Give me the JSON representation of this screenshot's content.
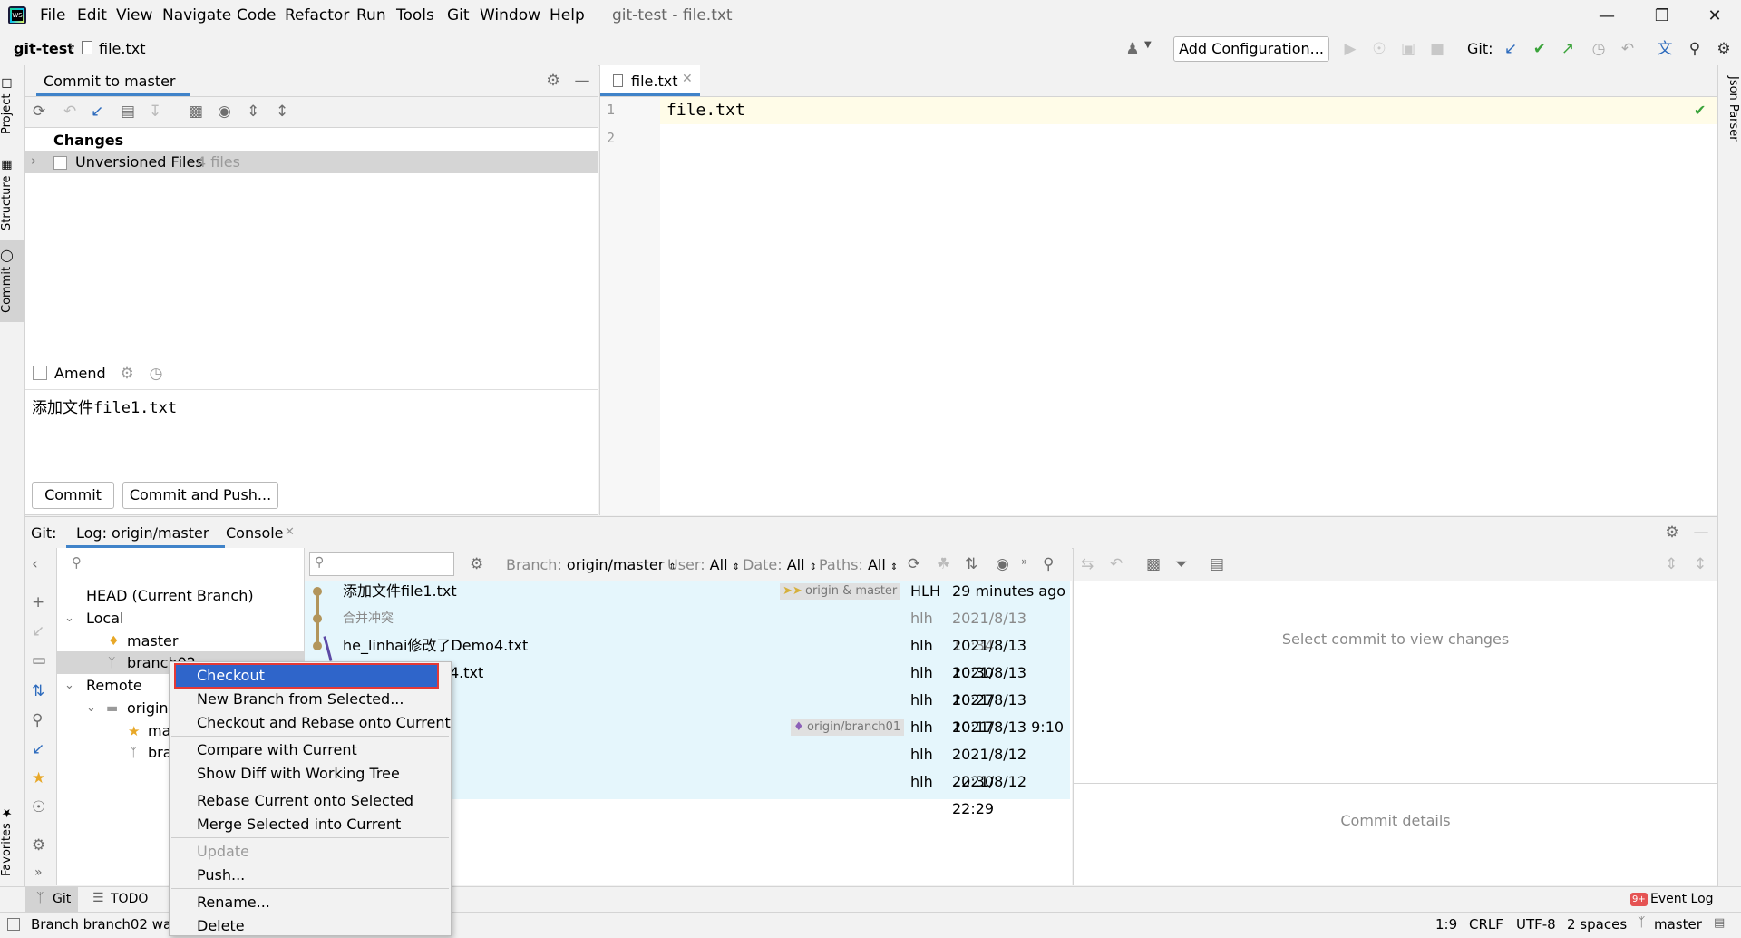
{
  "menubar": {
    "items": [
      "File",
      "Edit",
      "View",
      "Navigate",
      "Code",
      "Refactor",
      "Run",
      "Tools",
      "Git",
      "Window",
      "Help"
    ],
    "window_title": "git-test - file.txt"
  },
  "navbar": {
    "project": "git-test",
    "file": "file.txt",
    "add_config": "Add Configuration...",
    "git_label": "Git:"
  },
  "left_strip": {
    "project": "Project",
    "structure": "Structure",
    "commit": "Commit",
    "favorites": "Favorites"
  },
  "right_strip": {
    "json_parser": "Json Parser"
  },
  "commit_panel": {
    "title": "Commit to master",
    "changes_label": "Changes",
    "unversioned_label": "Unversioned Files",
    "unversioned_count": "4 files",
    "amend_label": "Amend",
    "message": "添加文件file1.txt",
    "commit_button": "Commit",
    "commit_push_button": "Commit and Push..."
  },
  "editor": {
    "tab": "file.txt",
    "lines": [
      {
        "num": "1",
        "text": "file.txt"
      },
      {
        "num": "2",
        "text": ""
      }
    ]
  },
  "git_panel": {
    "label": "Git:",
    "tab_log": "Log: origin/master",
    "tab_console": "Console",
    "filters": {
      "branch_key": "Branch:",
      "branch_val": "origin/master",
      "user_key": "User:",
      "user_val": "All",
      "date_key": "Date:",
      "date_val": "All",
      "paths_key": "Paths:",
      "paths_val": "All"
    },
    "branches": {
      "head": "HEAD (Current Branch)",
      "local": "Local",
      "master": "master",
      "branch02": "branch02",
      "remote": "Remote",
      "origin": "origin",
      "origin_master": "ma",
      "origin_branch": "bra"
    },
    "commits": [
      {
        "msg": "添加文件file1.txt",
        "tag": "origin & master",
        "author": "HLH",
        "date": "29 minutes ago"
      },
      {
        "msg": "合并冲突",
        "tag": "",
        "author": "hlh",
        "date": "2021/8/13 10:34"
      },
      {
        "msg": "he_linhai修改了Demo4.txt",
        "tag": "",
        "author": "hlh",
        "date": "2021/8/13 10:30"
      },
      {
        "msg": "4.txt",
        "tag": "",
        "author": "hlh",
        "date": "2021/8/13 10:27"
      },
      {
        "msg": "",
        "tag": "",
        "author": "hlh",
        "date": "2021/8/13 10:17"
      },
      {
        "msg": "",
        "tag": "origin/branch01",
        "author": "hlh",
        "date": "2021/8/13 9:10"
      },
      {
        "msg": "",
        "tag": "",
        "author": "hlh",
        "date": "2021/8/12 22:30"
      },
      {
        "msg": "",
        "tag": "",
        "author": "hlh",
        "date": "2021/8/12 22:29"
      }
    ],
    "select_commit": "Select commit to view changes",
    "commit_details": "Commit details"
  },
  "context_menu": {
    "items": [
      "Checkout",
      "New Branch from Selected...",
      "Checkout and Rebase onto Current",
      "Compare with Current",
      "Show Diff with Working Tree",
      "Rebase Current onto Selected",
      "Merge Selected into Current",
      "Update",
      "Push...",
      "Rename...",
      "Delete"
    ]
  },
  "bottom_tabs": {
    "git": "Git",
    "todo": "TODO",
    "event_log": "Event Log",
    "event_count": "9+"
  },
  "status_bar": {
    "message": "Branch branch02 was",
    "position": "1:9",
    "line_sep": "CRLF",
    "encoding": "UTF-8",
    "indent": "2 spaces",
    "branch": "master"
  },
  "colors": {
    "accent": "#2d6bbd",
    "selection": "#2f65ca",
    "log_bg": "#e5f6fc",
    "tag_gold": "#d5b03b",
    "tag_purple": "#8c60b8"
  }
}
